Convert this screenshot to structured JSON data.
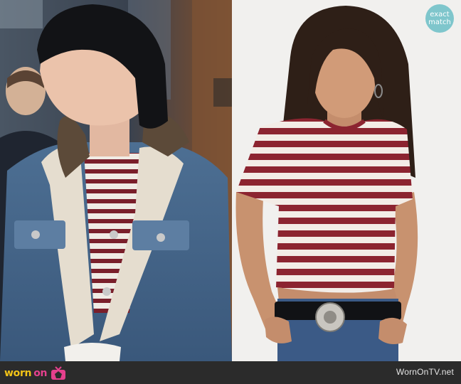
{
  "badge": {
    "line1": "exact",
    "line2": "match"
  },
  "footer": {
    "brand_word1": "worn",
    "brand_word2": "on",
    "logo_icon": "tv-icon",
    "site": "WornOnTV.net"
  },
  "colors": {
    "stripe_burgundy": "#8c2430",
    "stripe_cream": "#f3ece6",
    "badge_teal": "#7fc6cc",
    "brand_yellow": "#f2c317",
    "brand_pink": "#e5408d",
    "footer_bg": "#2b2b2b"
  }
}
